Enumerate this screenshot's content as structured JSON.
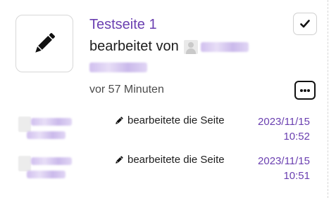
{
  "card": {
    "page_title": "Testseite 1",
    "edited_by_label": "bearbeitet von",
    "time_ago": "vor 57 Minuten",
    "icon": "pencil-icon",
    "mark_done_icon": "checkmark-icon",
    "more_icon": "ellipsis-icon"
  },
  "activity": [
    {
      "action": "bearbeitete die Seite",
      "date": "2023/11/15",
      "time": "10:52",
      "icon": "pencil-icon"
    },
    {
      "action": "bearbeitete die Seite",
      "date": "2023/11/15",
      "time": "10:51",
      "icon": "pencil-icon"
    }
  ],
  "colors": {
    "accent": "#6a3fb0",
    "text": "#1c1c1c",
    "muted": "#4b4b4b",
    "border": "#d7d7d7"
  }
}
